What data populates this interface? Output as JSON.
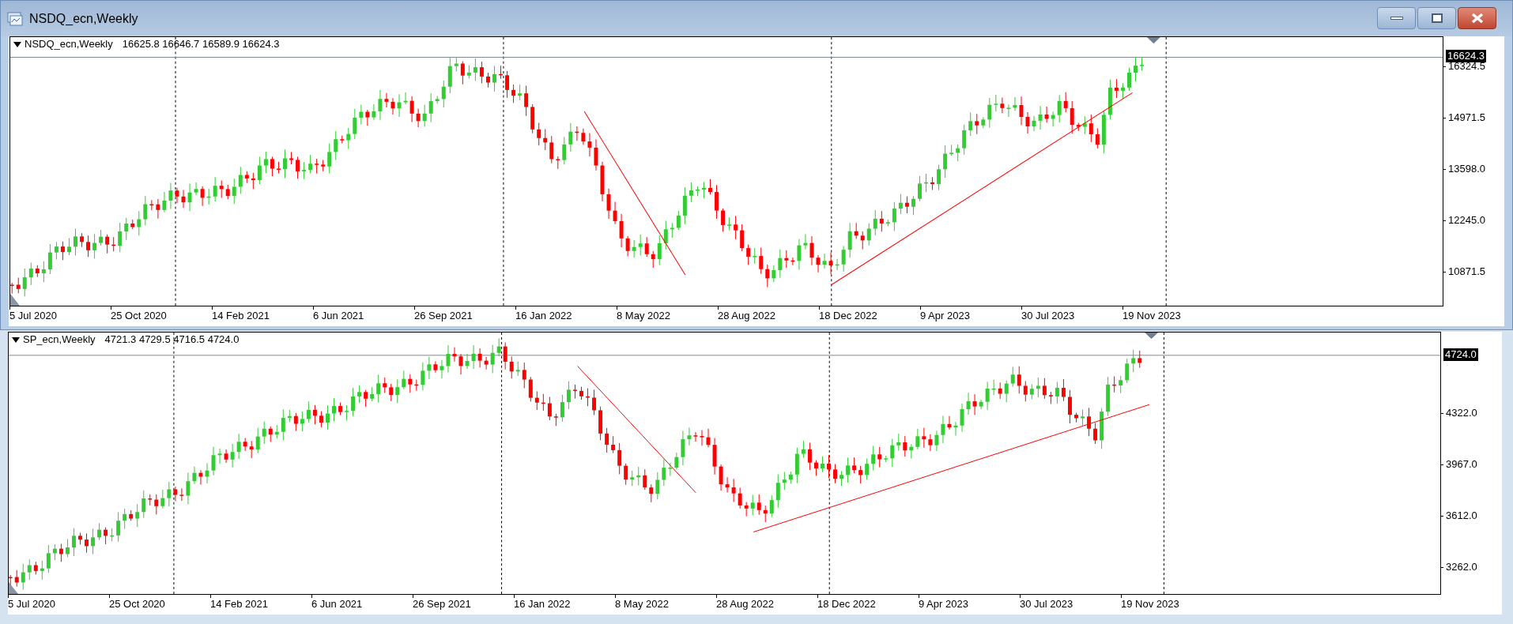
{
  "window": {
    "title": "NSDQ_ecn,Weekly"
  },
  "charts": [
    {
      "symbol": "NSDQ_ecn,Weekly",
      "ohlc": "16625.8 16646.7 16589.9 16624.3",
      "current_price": "16624.3",
      "price_ticks": [
        "16324.5",
        "14971.5",
        "13598.0",
        "12245.0",
        "10871.5"
      ],
      "date_labels": [
        "5 Jul 2020",
        "25 Oct 2020",
        "14 Feb 2021",
        "6 Jun 2021",
        "26 Sep 2021",
        "16 Jan 2022",
        "8 May 2022",
        "28 Aug 2022",
        "18 Dec 2022",
        "9 Apr 2023",
        "30 Jul 2023",
        "19 Nov 2023"
      ]
    },
    {
      "symbol": "SP_ecn,Weekly",
      "ohlc": "4721.3 4729.5 4716.5 4724.0",
      "current_price": "4724.0",
      "price_ticks": [
        "4322.0",
        "3967.0",
        "3612.0",
        "3262.0"
      ],
      "date_labels": [
        "5 Jul 2020",
        "25 Oct 2020",
        "14 Feb 2021",
        "6 Jun 2021",
        "26 Sep 2021",
        "16 Jan 2022",
        "8 May 2022",
        "28 Aug 2022",
        "18 Dec 2022",
        "9 Apr 2023",
        "30 Jul 2023",
        "19 Nov 2023"
      ]
    }
  ]
}
